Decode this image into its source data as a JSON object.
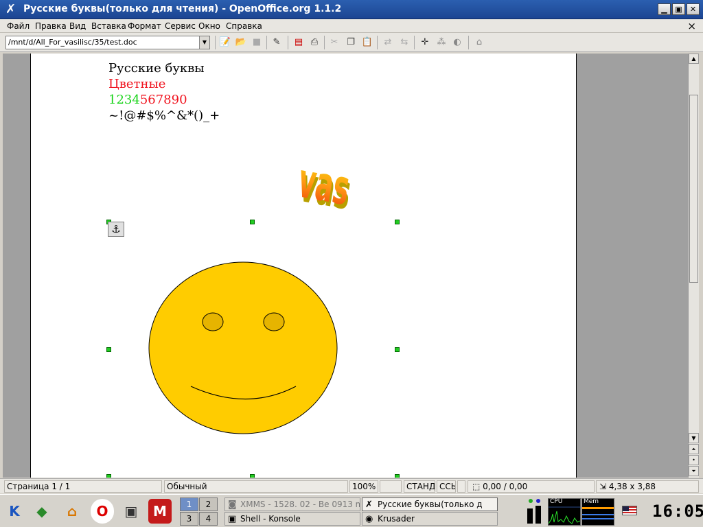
{
  "window": {
    "title": "Русские буквы(только для чтения) - OpenOffice.org 1.1.2",
    "buttons": {
      "minimize": "▁",
      "maximize": "▣",
      "close": "✕"
    }
  },
  "menu": {
    "items": [
      "Файл",
      "Правка",
      "Вид",
      "Вставка",
      "Формат",
      "Сервис",
      "Окно",
      "Справка"
    ],
    "close": "×"
  },
  "toolbar": {
    "url": "/mnt/d/All_For_vasilisc/35/test.doc"
  },
  "document": {
    "line1": "Русские буквы",
    "line2": "Цветные",
    "line3_green": "1234",
    "line3_red": "567890",
    "line4": "~!@#$%^&*()_+",
    "wordart": "vas"
  },
  "statusbar": {
    "page": "Страница  1 / 1",
    "style": "Обычный",
    "zoom": "100%",
    "mode": "СТАНД",
    "hyperlink": "ССЫ",
    "position": "0,00 / 0,00",
    "size": "4,38 x 3,88"
  },
  "taskbar": {
    "pager": [
      "1",
      "2",
      "3",
      "4"
    ],
    "tasks": [
      "XMMS - 1528. 02 - Be 0913 m",
      "Русские буквы(только д",
      "Shell - Konsole",
      "Krusader"
    ],
    "cpu_label": "CPU",
    "mem_label": "Mem",
    "clock": "16:05"
  }
}
